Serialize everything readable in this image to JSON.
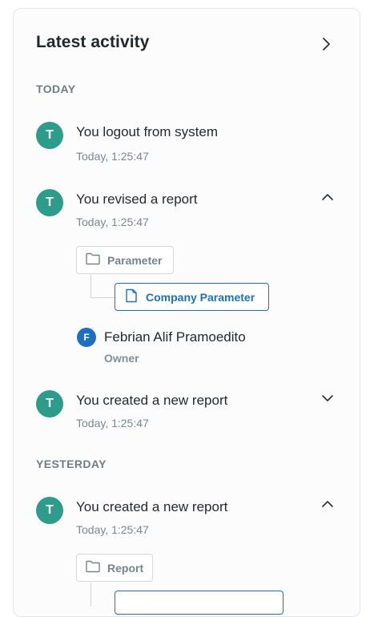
{
  "header": {
    "title": "Latest activity",
    "more_icon": "chevron-right-icon"
  },
  "sections": {
    "today": "TODAY",
    "yesterday": "YESTERDAY"
  },
  "activities": [
    {
      "avatar": "T",
      "title": "You logout from system",
      "time": "Today, 1:25:47"
    },
    {
      "avatar": "T",
      "title": "You revised a report",
      "time": "Today, 1:25:47",
      "expanded": true,
      "parent_folder": "Parameter",
      "child_file": "Company Parameter",
      "owner": {
        "initial": "F",
        "name": "Febrian Alif Pramoedito",
        "role": "Owner"
      }
    },
    {
      "avatar": "T",
      "title": "You created a new report",
      "time": "Today, 1:25:47",
      "expanded": false
    },
    {
      "avatar": "T",
      "title": "You created a new report",
      "time": "Today, 1:25:47",
      "expanded": true,
      "parent_folder": "Report"
    }
  ],
  "colors": {
    "avatar": "#2e9c8b",
    "accent": "#1f70b8",
    "owner_avatar": "#1f6fc0"
  }
}
